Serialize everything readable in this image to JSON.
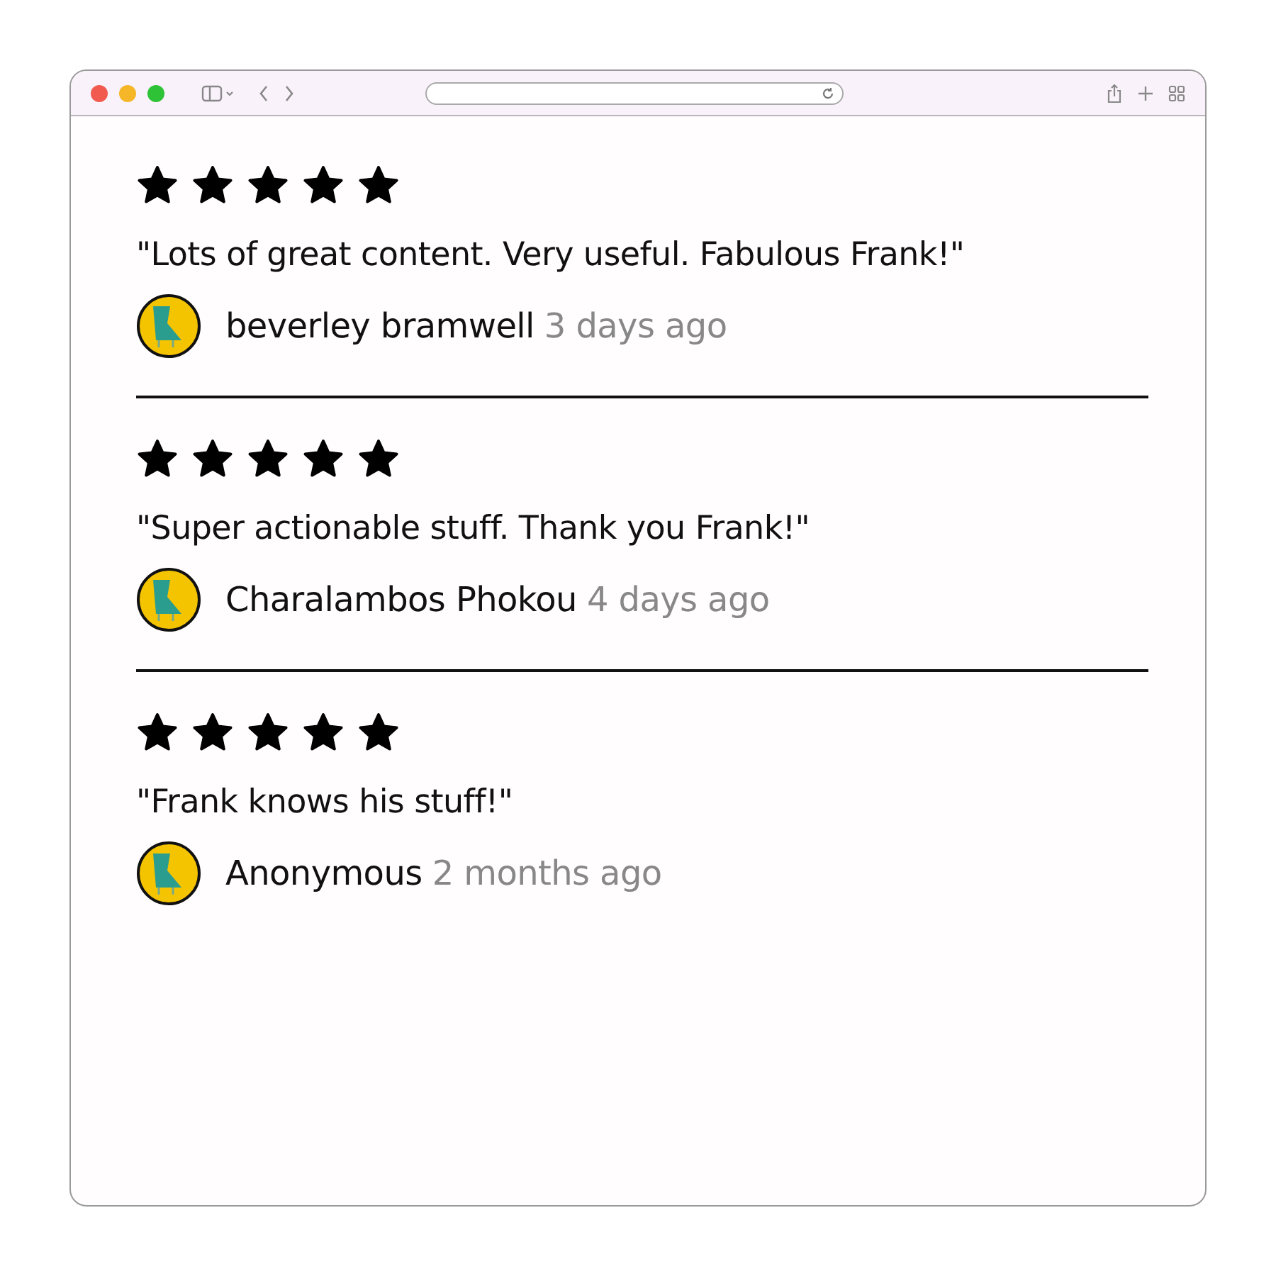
{
  "reviews": [
    {
      "stars": 5,
      "quote": "\"Lots of great content. Very useful. Fabulous Frank!\"",
      "author": "beverley bramwell",
      "time": "3 days ago"
    },
    {
      "stars": 5,
      "quote": "\"Super actionable stuff. Thank you Frank!\"",
      "author": "Charalambos Phokou",
      "time": "4 days ago"
    },
    {
      "stars": 5,
      "quote": "\"Frank knows his stuff!\"",
      "author": "Anonymous",
      "time": "2 months ago"
    }
  ]
}
